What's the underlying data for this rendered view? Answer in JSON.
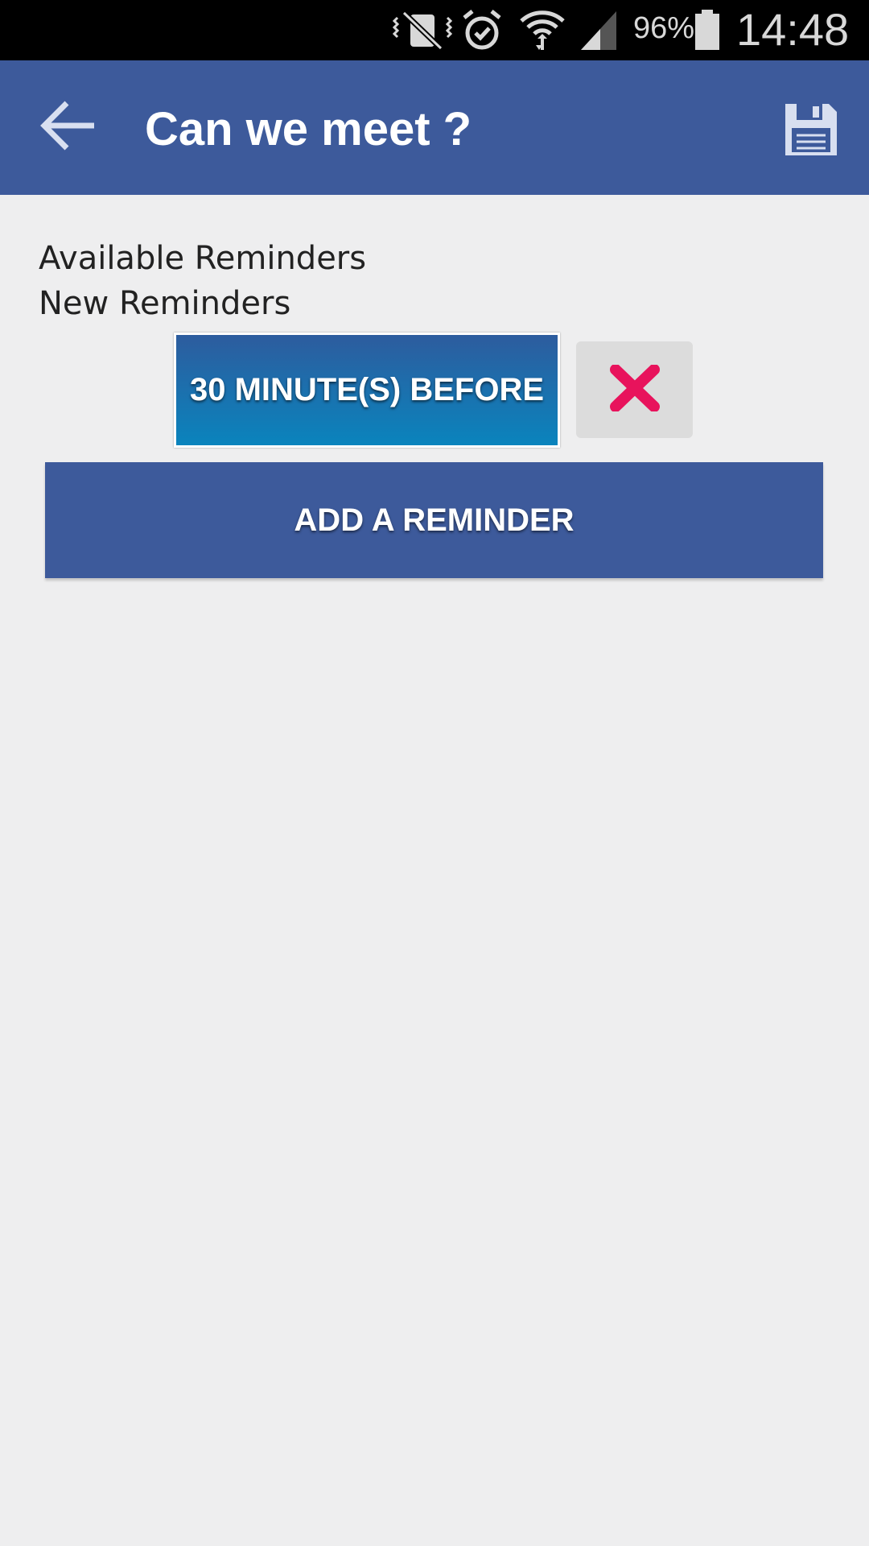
{
  "status_bar": {
    "battery_percent": "96%",
    "time": "14:48",
    "icons": [
      "vibrate-mute-icon",
      "alarm-icon",
      "wifi-icon",
      "signal-icon",
      "battery-icon"
    ]
  },
  "app_bar": {
    "title": "Can we meet ?",
    "back_icon": "arrow-left-icon",
    "save_icon": "floppy-disk-icon",
    "color": "#3d5a9b"
  },
  "content": {
    "available_label": "Available Reminders",
    "new_label": "New Reminders",
    "reminders": [
      {
        "label": "30 MINUTE(S) BEFORE"
      }
    ],
    "delete_icon": "close-x-icon",
    "delete_color": "#e8135c",
    "add_button_label": "ADD A REMINDER"
  }
}
